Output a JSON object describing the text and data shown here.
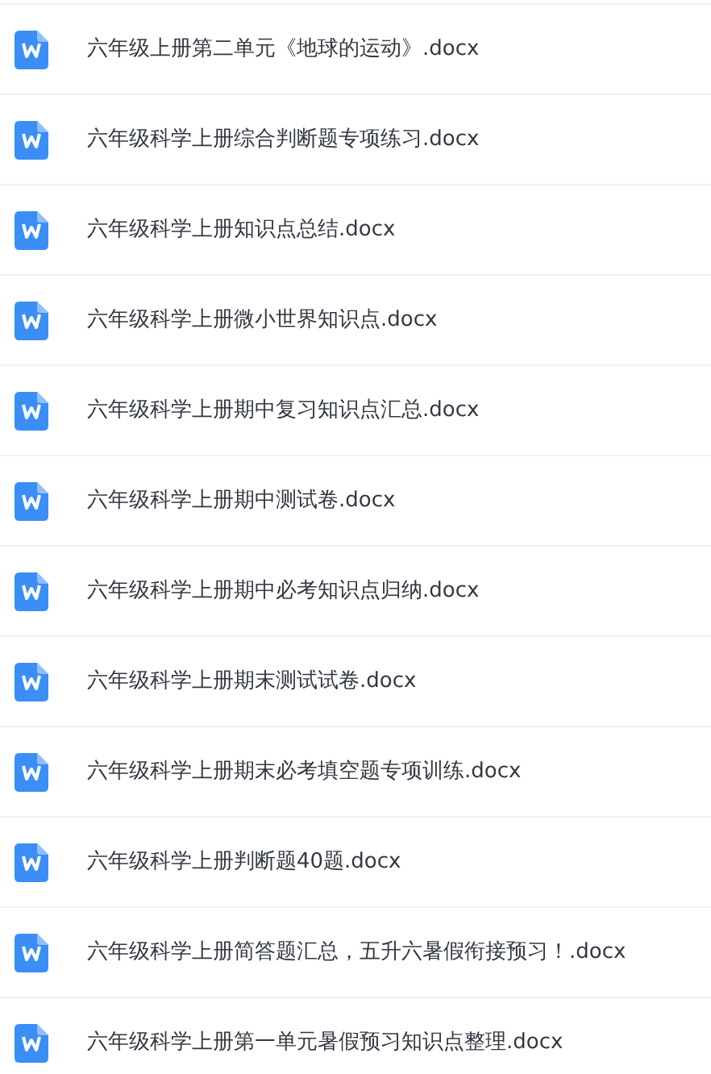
{
  "files": [
    {
      "name": "六年级上册第二单元《地球的运动》.docx",
      "kind": "word"
    },
    {
      "name": "六年级科学上册综合判断题专项练习.docx",
      "kind": "word"
    },
    {
      "name": "六年级科学上册知识点总结.docx",
      "kind": "word"
    },
    {
      "name": "六年级科学上册微小世界知识点.docx",
      "kind": "word"
    },
    {
      "name": "六年级科学上册期中复习知识点汇总.docx",
      "kind": "word"
    },
    {
      "name": "六年级科学上册期中测试卷.docx",
      "kind": "word"
    },
    {
      "name": "六年级科学上册期中必考知识点归纳.docx",
      "kind": "word"
    },
    {
      "name": "六年级科学上册期末测试试卷.docx",
      "kind": "word"
    },
    {
      "name": "六年级科学上册期末必考填空题专项训练.docx",
      "kind": "word"
    },
    {
      "name": "六年级科学上册判断题40题.docx",
      "kind": "word"
    },
    {
      "name": "六年级科学上册简答题汇总，五升六暑假衔接预习！.docx",
      "kind": "word"
    },
    {
      "name": "六年级科学上册第一单元暑假预习知识点整理.docx",
      "kind": "word"
    }
  ]
}
